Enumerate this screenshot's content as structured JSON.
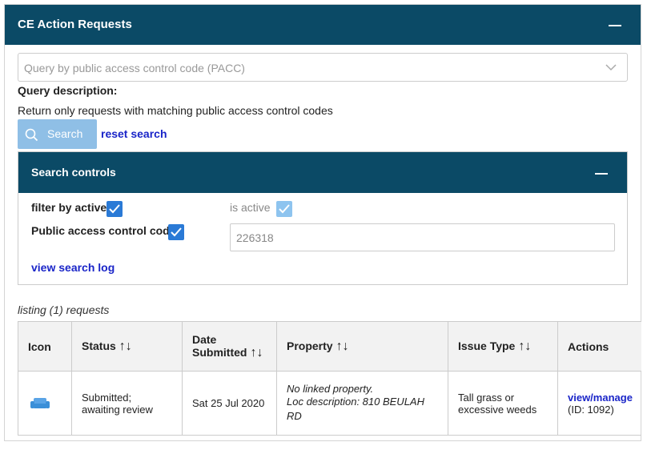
{
  "header": {
    "title": "CE Action Requests"
  },
  "query": {
    "placeholder": "Query by public access control code (PACC)",
    "description_label": "Query description:",
    "description_text": "Return only requests with matching public access control codes"
  },
  "buttons": {
    "search_label": "Search",
    "reset_label": "reset search"
  },
  "search_controls": {
    "title": "Search controls",
    "filter_by_active_label": "filter by active",
    "filter_by_active_checked": true,
    "is_active_label": "is active",
    "is_active_checked": true,
    "pacc_label": "Public access control code",
    "pacc_checked": true,
    "pacc_value": "226318",
    "view_log_label": "view search log"
  },
  "listing": {
    "summary": "listing (1) requests",
    "columns": {
      "icon": "Icon",
      "status": "Status",
      "date_line1": "Date",
      "date_line2": "Submitted",
      "property": "Property",
      "issue_type": "Issue Type",
      "actions": "Actions"
    },
    "sort_glyph": "↑↓",
    "rows": [
      {
        "icon": "couch-icon",
        "status_line1": "Submitted;",
        "status_line2": "awaiting review",
        "date": "Sat 25 Jul 2020",
        "property_line1": "No linked property.",
        "property_line2": "Loc description: 810 BEULAH RD",
        "issue_line1": "Tall grass or",
        "issue_line2": "excessive weeds",
        "action_link": "view/manage",
        "action_id": "(ID: 1092)"
      }
    ]
  },
  "colors": {
    "header_bg": "#0b4a66",
    "checkbox": "#2a7ad6",
    "link": "#1a25c8",
    "search_btn": "#8fbfe6"
  }
}
